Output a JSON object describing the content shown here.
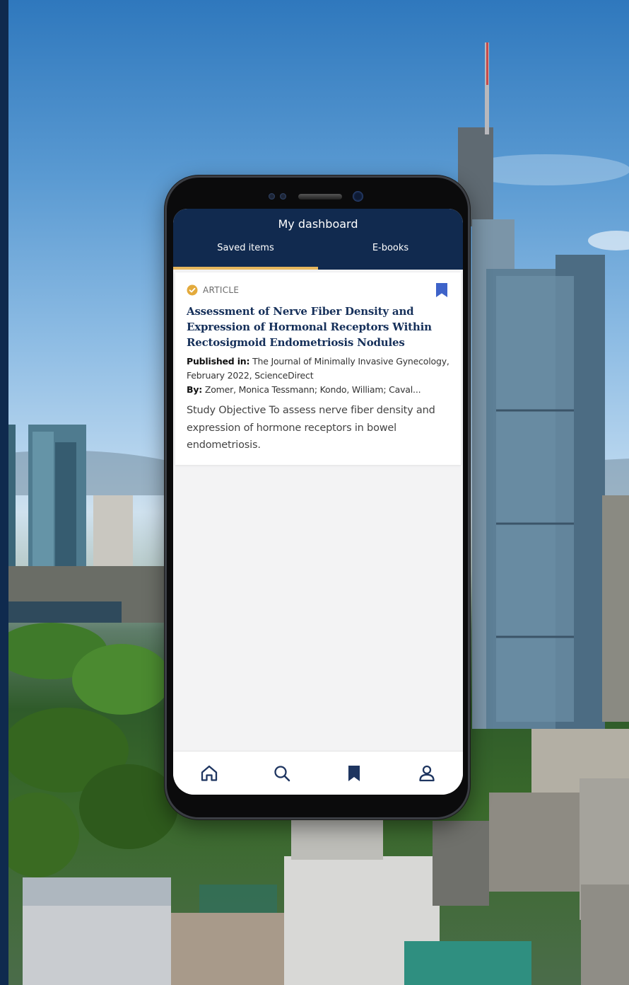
{
  "header": {
    "title": "My dashboard",
    "tabs": [
      {
        "label": "Saved items",
        "active": true
      },
      {
        "label": "E-books",
        "active": false
      }
    ]
  },
  "card": {
    "type_label": "ARTICLE",
    "title": "Assessment of Nerve Fiber Density and Expression of Hormonal Receptors Within Rectosigmoid Endometriosis Nodules",
    "published_label": "Published in:",
    "published_value": "The Journal of Minimally Invasive Gynecology, February 2022, ScienceDirect",
    "by_label": "By:",
    "by_value": "Zomer, Monica Tessmann; Kondo, William; Caval...",
    "abstract": "Study Objective To assess nerve fiber density and expression of hormone receptors in bowel endometriosis.",
    "bookmarked": true
  },
  "bottom_nav": [
    {
      "icon": "home-icon"
    },
    {
      "icon": "search-icon"
    },
    {
      "icon": "bookmark-icon",
      "active": true
    },
    {
      "icon": "profile-icon"
    }
  ],
  "colors": {
    "header_bg": "#112a4f",
    "tab_indicator": "#e6b75d",
    "title_text": "#16305a",
    "bookmark_blue": "#3e63c9",
    "nav_icon": "#1e3560"
  }
}
